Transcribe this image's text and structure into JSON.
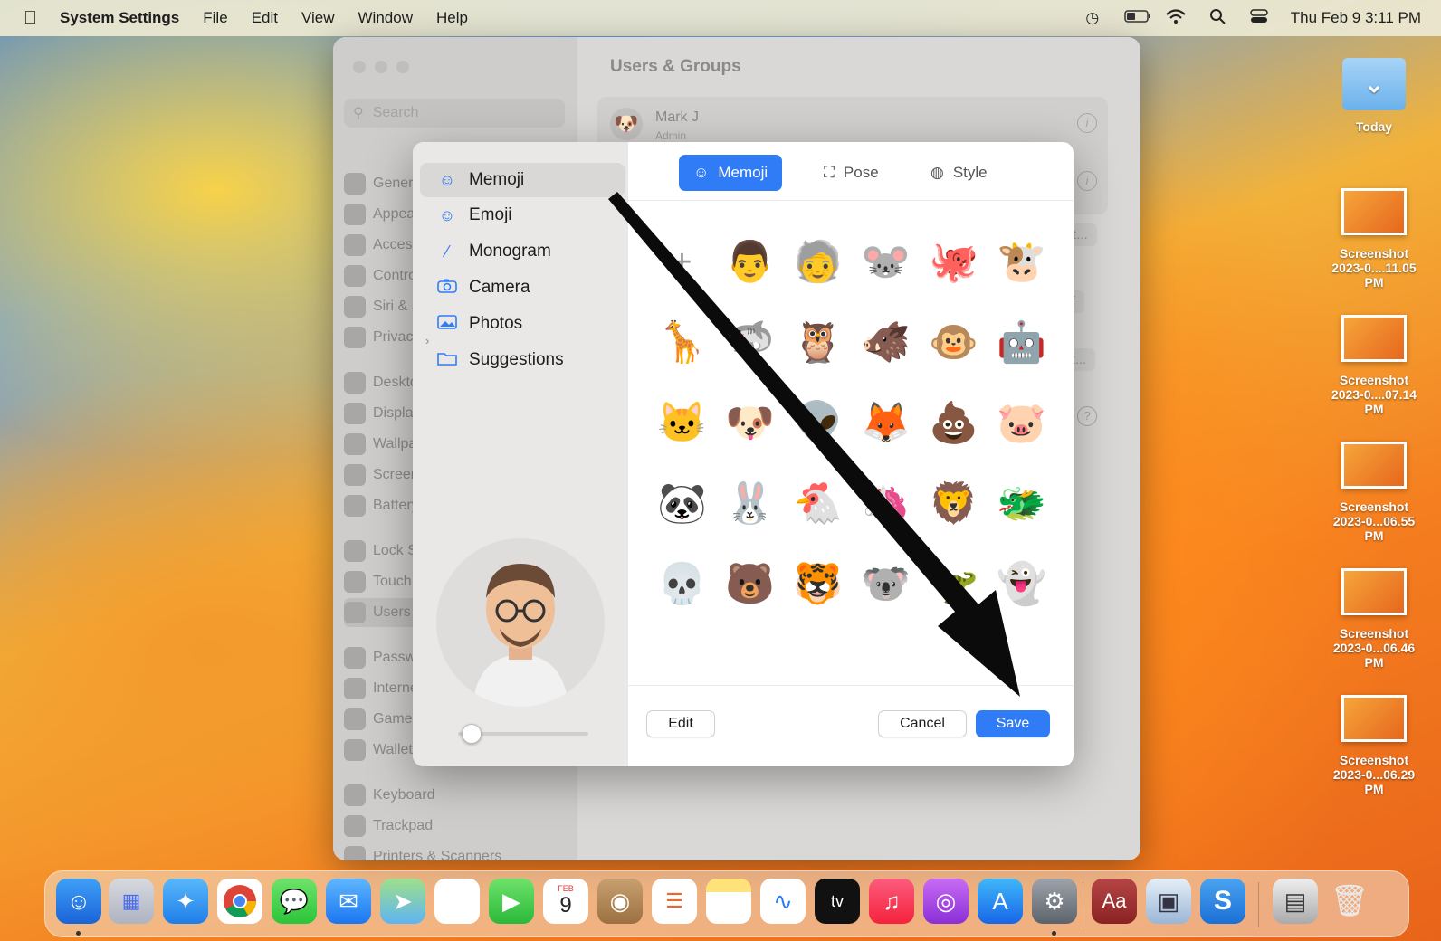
{
  "menubar": {
    "app_name": "System Settings",
    "menus": [
      "File",
      "Edit",
      "View",
      "Window",
      "Help"
    ],
    "clock": "Thu Feb 9  3:11 PM"
  },
  "window": {
    "search_placeholder": "Search",
    "sidebar_items": [
      "General",
      "Appearance",
      "Accessibility",
      "Control Centre",
      "Siri & Spotlight",
      "Privacy & Security",
      "Desktop & Dock",
      "Displays",
      "Wallpaper",
      "Screen Saver",
      "Battery",
      "Lock Screen",
      "Touch ID & Password",
      "Users & Groups",
      "Passwords",
      "Internet Accounts",
      "Game Center",
      "Wallet & Apple Pay",
      "Keyboard",
      "Trackpad",
      "Printers & Scanners"
    ],
    "title": "Users & Groups",
    "user_name": "Mark J",
    "user_role": "Admin",
    "buttons": [
      "ount...",
      "Off",
      "Edit..."
    ],
    "help": "?"
  },
  "dialog": {
    "sources": [
      {
        "label": "Memoji",
        "icon": "memoji-icon"
      },
      {
        "label": "Emoji",
        "icon": "smiley-icon"
      },
      {
        "label": "Monogram",
        "icon": "pencil-icon"
      },
      {
        "label": "Camera",
        "icon": "camera-icon"
      },
      {
        "label": "Photos",
        "icon": "photos-icon"
      },
      {
        "label": "Suggestions",
        "icon": "folder-icon"
      }
    ],
    "tabs": [
      "Memoji",
      "Pose",
      "Style"
    ],
    "memoji_grid": [
      "+",
      "👨",
      "🧓",
      "🐭",
      "🐙",
      "🐮",
      "🦒",
      "🦈",
      "🦉",
      "🐗",
      "🐵",
      "🤖",
      "🐱",
      "🐶",
      "👽",
      "🦊",
      "💩",
      "🐷",
      "🐼",
      "🐰",
      "🐔",
      "🦄",
      "🦁",
      "🐲",
      "💀",
      "🐻",
      "🐯",
      "🐨",
      "🦖",
      "👻"
    ],
    "preview_avatar": "🧔",
    "zoom_level": 0.05,
    "buttons": {
      "edit": "Edit",
      "cancel": "Cancel",
      "save": "Save"
    }
  },
  "desktop": {
    "folder_label": "Today",
    "screenshots": [
      {
        "line1": "Screenshot",
        "line2": "2023-0....11.05 PM"
      },
      {
        "line1": "Screenshot",
        "line2": "2023-0....07.14 PM"
      },
      {
        "line1": "Screenshot",
        "line2": "2023-0...06.55 PM"
      },
      {
        "line1": "Screenshot",
        "line2": "2023-0...06.46 PM"
      },
      {
        "line1": "Screenshot",
        "line2": "2023-0...06.29 PM"
      }
    ]
  },
  "dock": {
    "calendar_month": "FEB",
    "calendar_day": "9",
    "dictionary_label": "Aa",
    "tv_label": "tv"
  },
  "colors": {
    "accent": "#2f7cf6",
    "arrow": "#0b0b0b"
  }
}
